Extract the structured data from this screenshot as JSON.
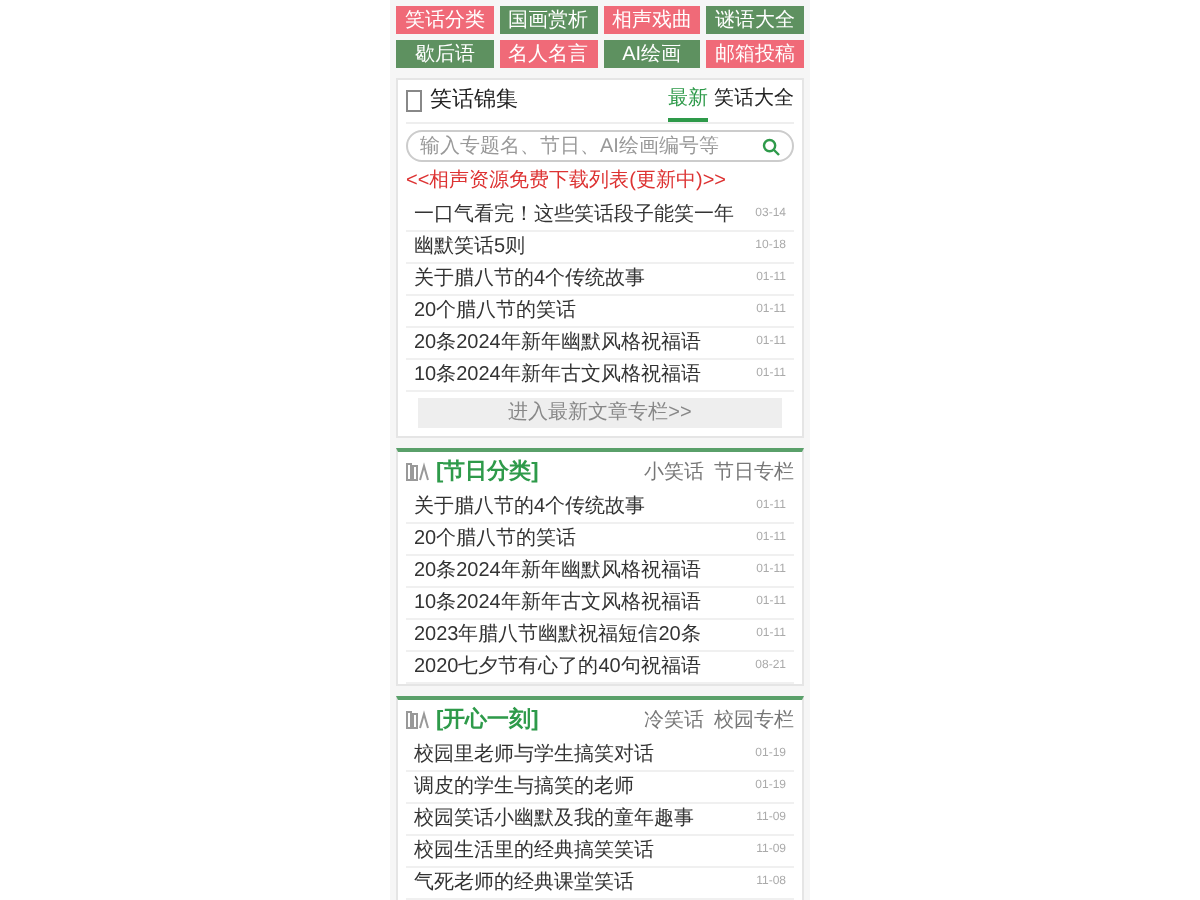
{
  "nav": [
    {
      "label": "笑话分类",
      "color": "#f06a78"
    },
    {
      "label": "国画赏析",
      "color": "#5e9160"
    },
    {
      "label": "相声戏曲",
      "color": "#f06a78"
    },
    {
      "label": "谜语大全",
      "color": "#5e9160"
    },
    {
      "label": "歇后语",
      "color": "#5e9160"
    },
    {
      "label": "名人名言",
      "color": "#f06a78"
    },
    {
      "label": "AI绘画",
      "color": "#5e9160"
    },
    {
      "label": "邮箱投稿",
      "color": "#f06a78"
    }
  ],
  "main": {
    "title": "笑话锦集",
    "tabs": [
      {
        "label": "最新",
        "selected": true
      },
      {
        "label": "笑话大全",
        "selected": false
      }
    ],
    "search": {
      "placeholder": "输入专题名、节日、AI绘画编号等"
    },
    "notice": "<<相声资源免费下载列表(更新中)>>",
    "items": [
      {
        "title": "一口气看完！这些笑话段子能笑一年",
        "date": "03-14"
      },
      {
        "title": "幽默笑话5则",
        "date": "10-18"
      },
      {
        "title": "关于腊八节的4个传统故事",
        "date": "01-11"
      },
      {
        "title": "20个腊八节的笑话",
        "date": "01-11"
      },
      {
        "title": "20条2024年新年幽默风格祝福语",
        "date": "01-11"
      },
      {
        "title": "10条2024年新年古文风格祝福语",
        "date": "01-11"
      }
    ],
    "more": "进入最新文章专栏>>"
  },
  "sections": [
    {
      "title": "[节日分类]",
      "links": [
        "小笑话",
        "节日专栏"
      ],
      "items": [
        {
          "title": "关于腊八节的4个传统故事",
          "date": "01-11"
        },
        {
          "title": "20个腊八节的笑话",
          "date": "01-11"
        },
        {
          "title": "20条2024年新年幽默风格祝福语",
          "date": "01-11"
        },
        {
          "title": "10条2024年新年古文风格祝福语",
          "date": "01-11"
        },
        {
          "title": "2023年腊八节幽默祝福短信20条",
          "date": "01-11"
        },
        {
          "title": "2020七夕节有心了的40句祝福语",
          "date": "08-21"
        }
      ]
    },
    {
      "title": "[开心一刻]",
      "links": [
        "冷笑话",
        "校园专栏"
      ],
      "items": [
        {
          "title": "校园里老师与学生搞笑对话",
          "date": "01-19"
        },
        {
          "title": "调皮的学生与搞笑的老师",
          "date": "01-19"
        },
        {
          "title": "校园笑话小幽默及我的童年趣事",
          "date": "11-09"
        },
        {
          "title": "校园生活里的经典搞笑笑话",
          "date": "11-09"
        },
        {
          "title": "气死老师的经典课堂笑话",
          "date": "11-08"
        }
      ]
    }
  ]
}
